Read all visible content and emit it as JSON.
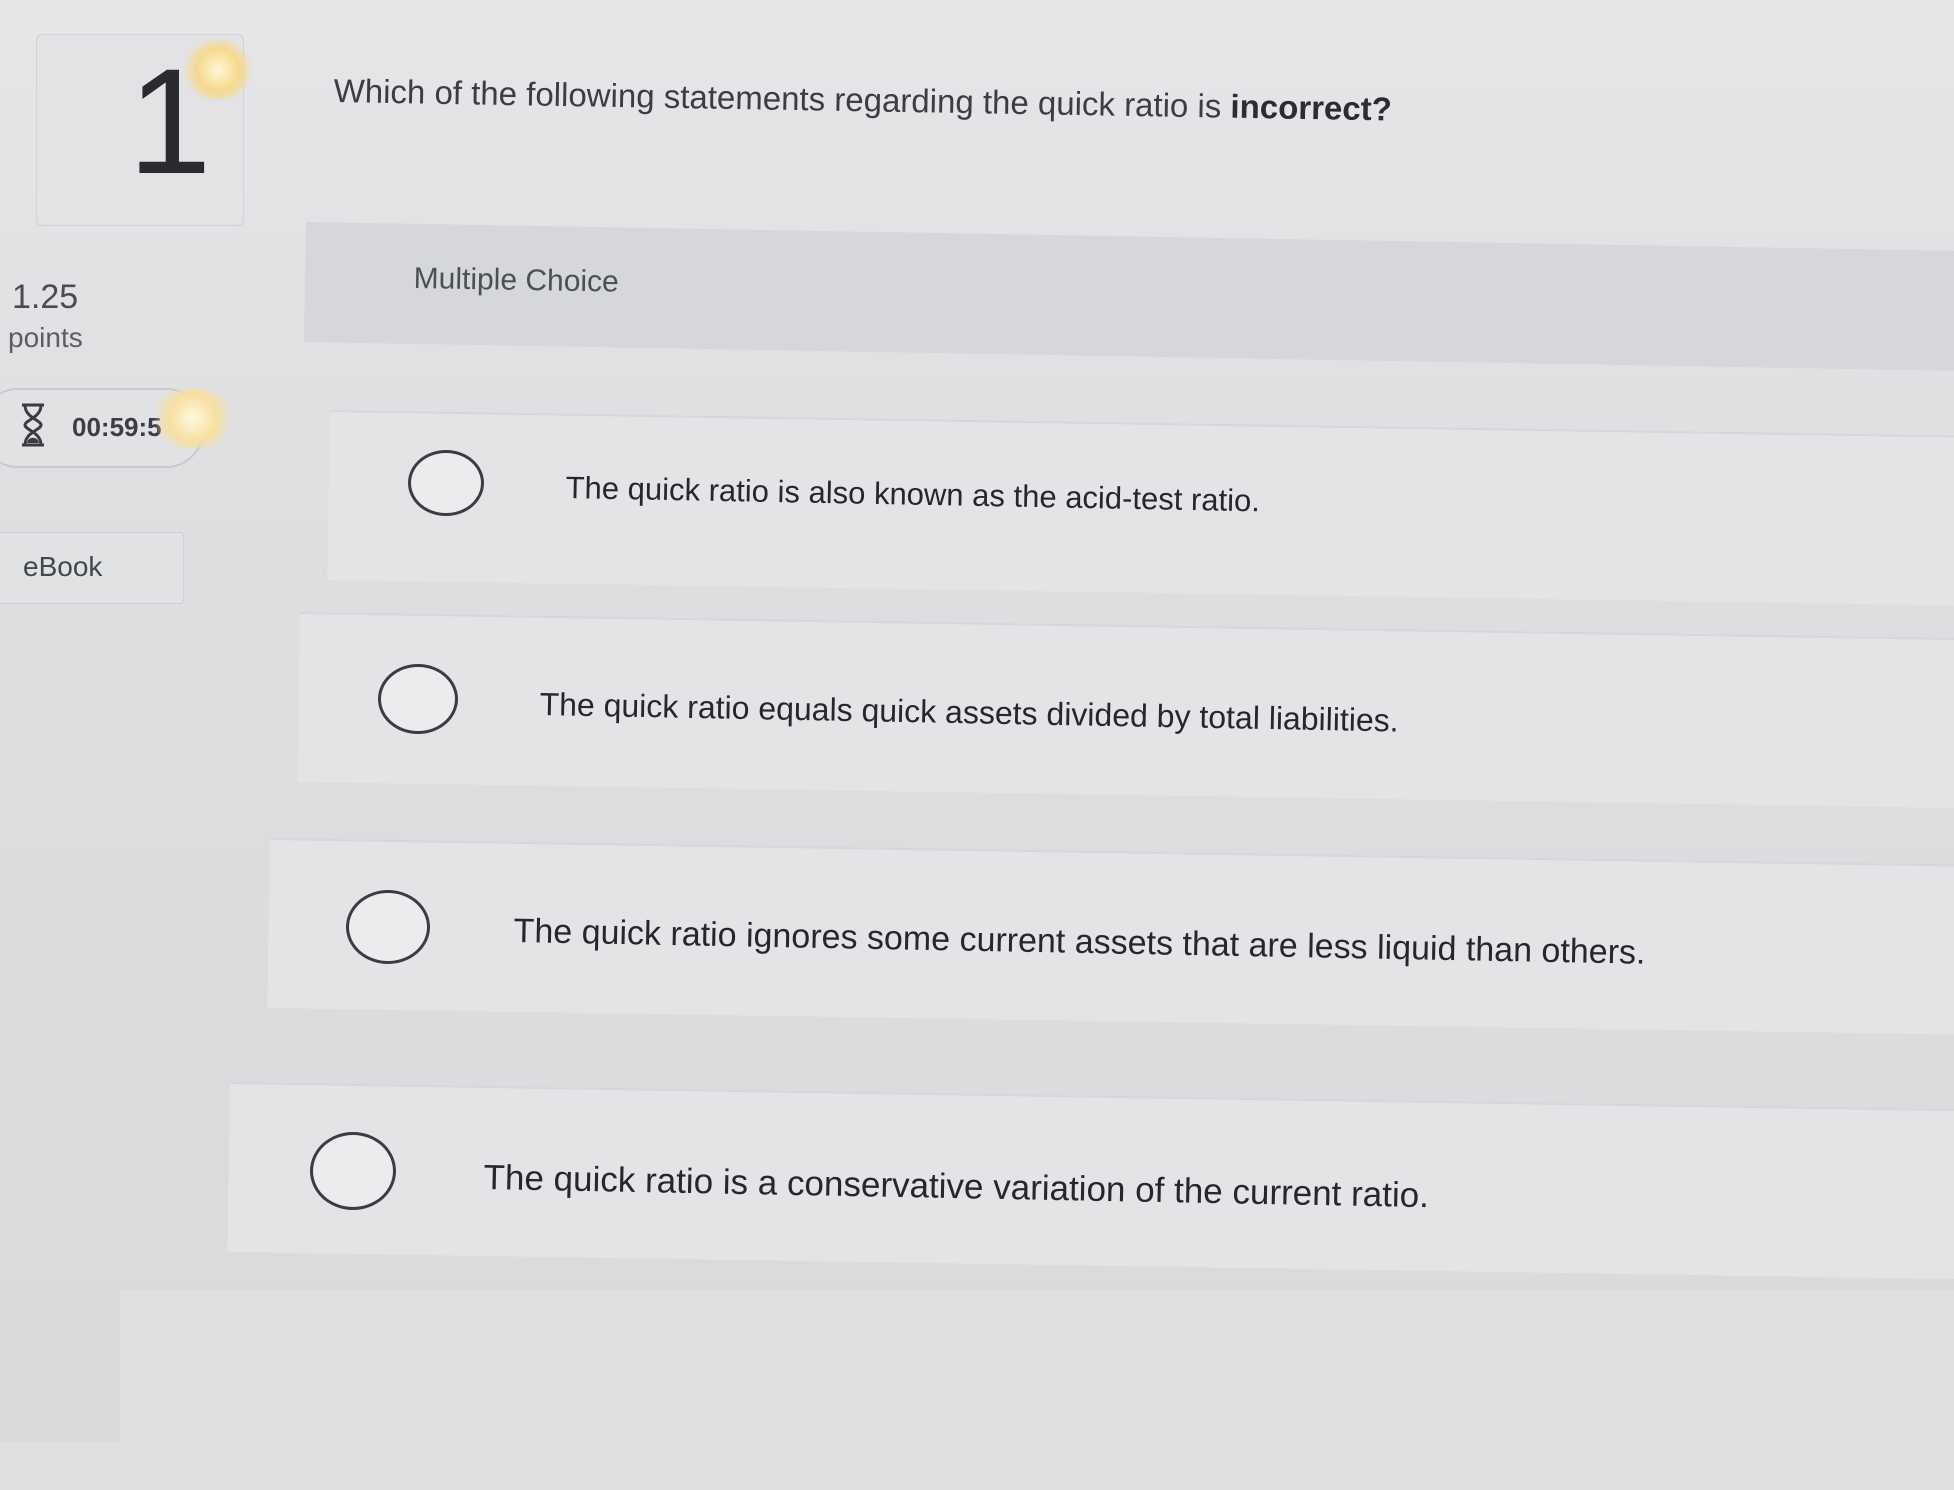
{
  "question": {
    "number": "1",
    "text_before": "Which of the following statements regarding the quick ratio is ",
    "text_emphasis": "incorrect?",
    "points_value": "1.25",
    "points_label": "points",
    "timer": "00:59:5",
    "ebook_label": "eBook",
    "type_label": "Multiple Choice"
  },
  "answers": [
    {
      "text": "The quick ratio is also known as the acid-test ratio."
    },
    {
      "text": "The quick ratio equals quick assets divided by total liabilities."
    },
    {
      "text": "The quick ratio ignores some current assets that are less liquid than others."
    },
    {
      "text": "The quick ratio is a conservative variation of the current ratio."
    }
  ]
}
